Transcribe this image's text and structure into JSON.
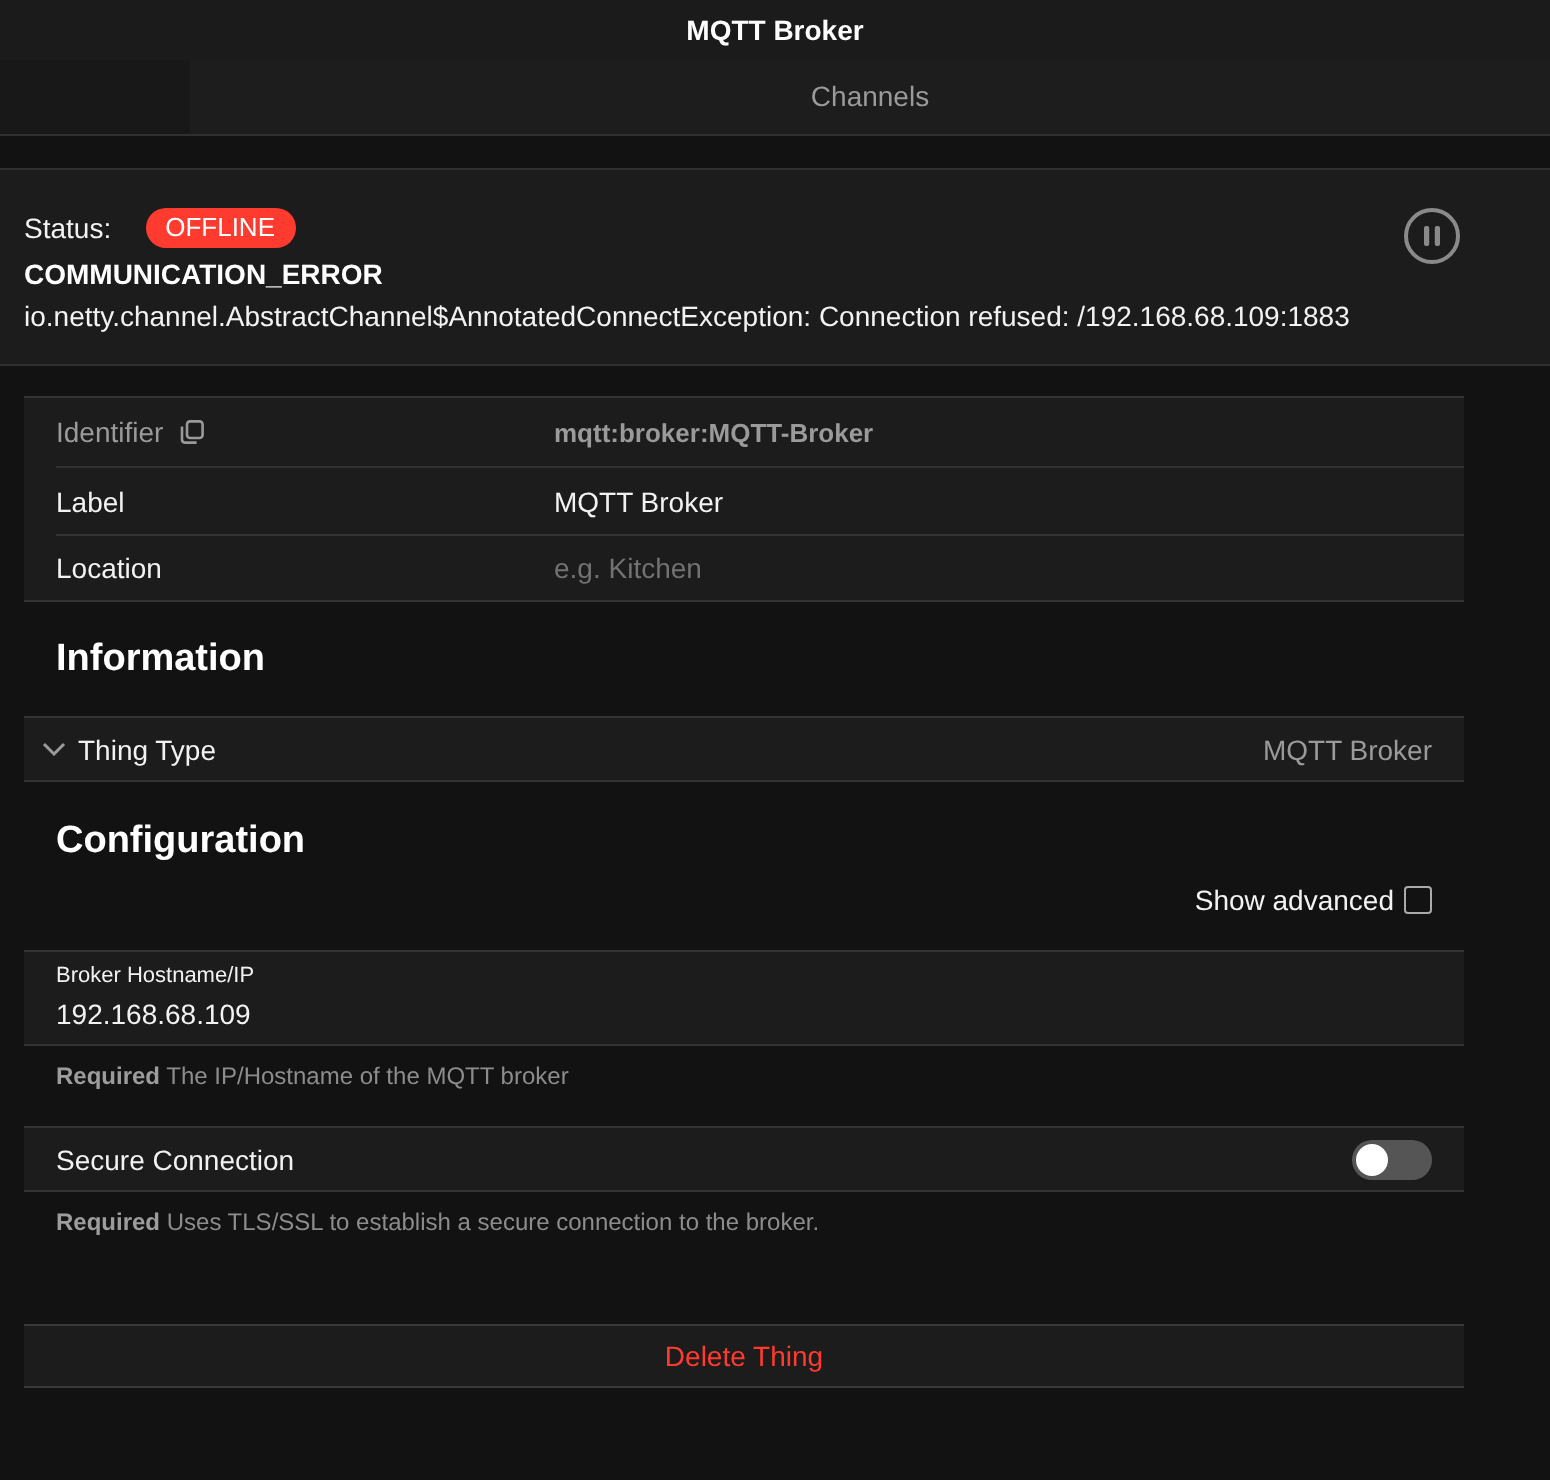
{
  "header": {
    "title": "MQTT Broker"
  },
  "tabs": [
    {
      "label": "Channels",
      "selected": false
    }
  ],
  "status": {
    "label": "Status:",
    "state": "OFFLINE",
    "detail": "COMMUNICATION_ERROR",
    "description": "io.netty.channel.AbstractChannel$AnnotatedConnectException: Connection refused: /192.168.68.109:1883"
  },
  "properties": [
    {
      "kind": "readonly",
      "label": "Identifier",
      "value": "mqtt:broker:MQTT-Broker"
    },
    {
      "kind": "input",
      "label": "Label",
      "value": "MQTT Broker"
    },
    {
      "kind": "input",
      "label": "Location",
      "placeholder": "e.g. Kitchen"
    }
  ],
  "information": {
    "heading": "Information",
    "items": [
      {
        "label": "Thing Type",
        "value": "MQTT Broker",
        "expanded": false
      }
    ]
  },
  "configuration": {
    "heading": "Configuration",
    "show_advanced": {
      "label": "Show advanced",
      "checked": false
    },
    "parameters": [
      {
        "kind": "text",
        "label": "Broker Hostname/IP",
        "value": "192.168.68.109",
        "help": "**Required** The IP/Hostname of the MQTT broker"
      },
      {
        "kind": "toggle",
        "label": "Secure Connection",
        "on": false,
        "help": "**Required** Uses TLS/SSL to establish a secure connection to the broker."
      }
    ]
  },
  "delete_button": "Delete Thing"
}
